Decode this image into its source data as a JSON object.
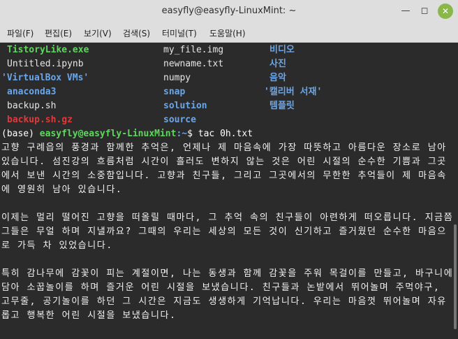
{
  "window": {
    "title": "easyfly@easyfly-LinuxMint: ~",
    "min_icon": "minimize-icon",
    "max_icon": "maximize-icon",
    "close_icon": "close-icon"
  },
  "menu": [
    "파일(F)",
    "편집(E)",
    "보기(V)",
    "검색(S)",
    "터미널(T)",
    "도움말(H)"
  ],
  "ls": {
    "col1": [
      "TistoryLike.exe",
      "Untitled.ipynb",
      "'VirtualBox VMs'",
      "anaconda3",
      "backup.sh",
      "backup.sh.gz"
    ],
    "col2": [
      "my_file.img",
      "newname.txt",
      "numpy",
      "snap",
      "solution",
      "source"
    ],
    "col3": [
      "비디오",
      "사진",
      "음악",
      "'캘리버 서재'",
      "템플릿"
    ]
  },
  "prompt": {
    "env": "(base) ",
    "user": "easyfly@easyfly-LinuxMint",
    "path": ":~",
    "sym": "$ ",
    "cmd": "tac 0h.txt"
  },
  "paragraphs": [
    "고향 구례읍의 풍경과 함께한 추억은, 언제나 제 마음속에 가장 따뜻하고 아름다운 장소로 남아 있습니다. 섬진강의 흐름처럼 시간이 흘러도 변하지 않는 것은 어린 시절의 순수한 기쁨과 그곳에서 보낸 시간의 소중함입니다. 고향과 친구들, 그리고 그곳에서의 무한한 추억들이 제 마음속에 영원히 남아 있습니다.",
    "이제는 멀리 떨어진 고향을 떠올릴 때마다, 그 추억 속의 친구들이 아련하게 떠오릅니다. 지금쯤 그들은 무얼 하며 지낼까요? 그때의 우리는 세상의 모든 것이 신기하고 즐거웠던 순수한 마음으로 가득 차 있었습니다.",
    "특히 감나무에 감꽃이 피는 계절이면, 나는 동생과 함께 감꽃을 주워 목걸이를 만들고, 바구니에 담아 소꿉놀이를 하며 즐거운 어린 시절을 보냈습니다. 친구들과 논밭에서 뛰어놀며 주먹야구, 고무줄, 공기놀이를 하던 그 시간은 지금도 생생하게 기억납니다. 우리는 마음껏 뛰어놀며 자유롭고 행복한 어린 시절을 보냈습니다."
  ]
}
